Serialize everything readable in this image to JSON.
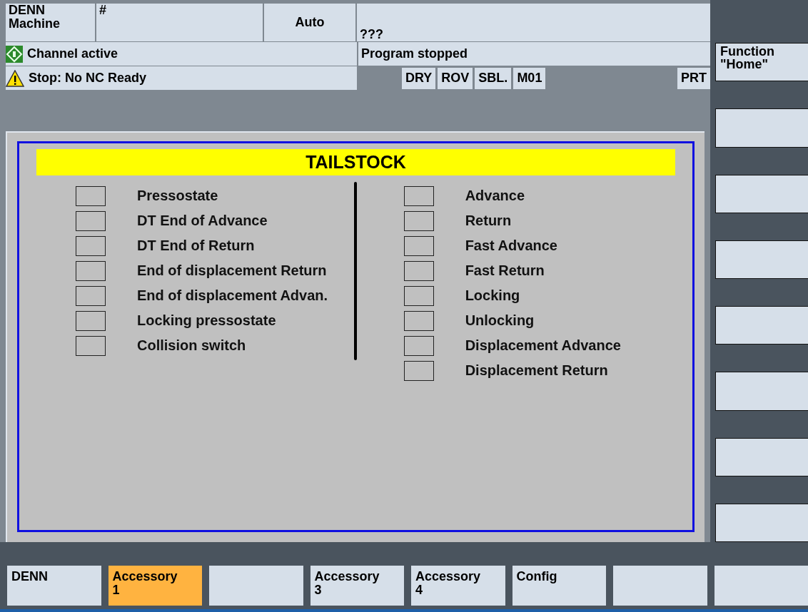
{
  "header": {
    "machine": "DENN\nMachine",
    "program_path": "#",
    "mode": "Auto",
    "program_name": "???",
    "channel_status": "Channel active",
    "program_status": "Program stopped",
    "alarm": "Stop: No NC Ready",
    "flags": [
      {
        "label": "DRY"
      },
      {
        "label": "ROV"
      },
      {
        "label": "SBL."
      },
      {
        "label": "M01"
      }
    ],
    "print_flag": "PRT"
  },
  "panel": {
    "title": "TAILSTOCK",
    "inputs": [
      {
        "label": "Pressostate"
      },
      {
        "label": "DT End of Advance"
      },
      {
        "label": "DT End of Return"
      },
      {
        "label": "End of displacement Return"
      },
      {
        "label": "End of displacement Advan."
      },
      {
        "label": "Locking pressostate"
      },
      {
        "label": "Collision switch"
      }
    ],
    "outputs": [
      {
        "label": "Advance"
      },
      {
        "label": "Return"
      },
      {
        "label": "Fast Advance"
      },
      {
        "label": "Fast Return"
      },
      {
        "label": "Locking"
      },
      {
        "label": "Unlocking"
      },
      {
        "label": "Displacement Advance"
      },
      {
        "label": "Displacement Return"
      }
    ]
  },
  "vertical_softkeys": [
    {
      "kind": "labeled",
      "label": "Function\n\"Home\""
    },
    {
      "kind": "blank"
    },
    {
      "kind": "blank"
    },
    {
      "kind": "blank"
    },
    {
      "kind": "blank"
    },
    {
      "kind": "blank"
    },
    {
      "kind": "blank"
    },
    {
      "kind": "blank"
    }
  ],
  "horizontal_softkeys": [
    {
      "label": "DENN",
      "selected": false
    },
    {
      "label": "Accessory\n1",
      "selected": true
    },
    {
      "selected": false
    },
    {
      "label": "Accessory\n3",
      "selected": false
    },
    {
      "label": "Accessory\n4",
      "selected": false
    },
    {
      "label": "Config",
      "selected": false
    },
    {
      "selected": false
    },
    {
      "selected": false
    }
  ]
}
